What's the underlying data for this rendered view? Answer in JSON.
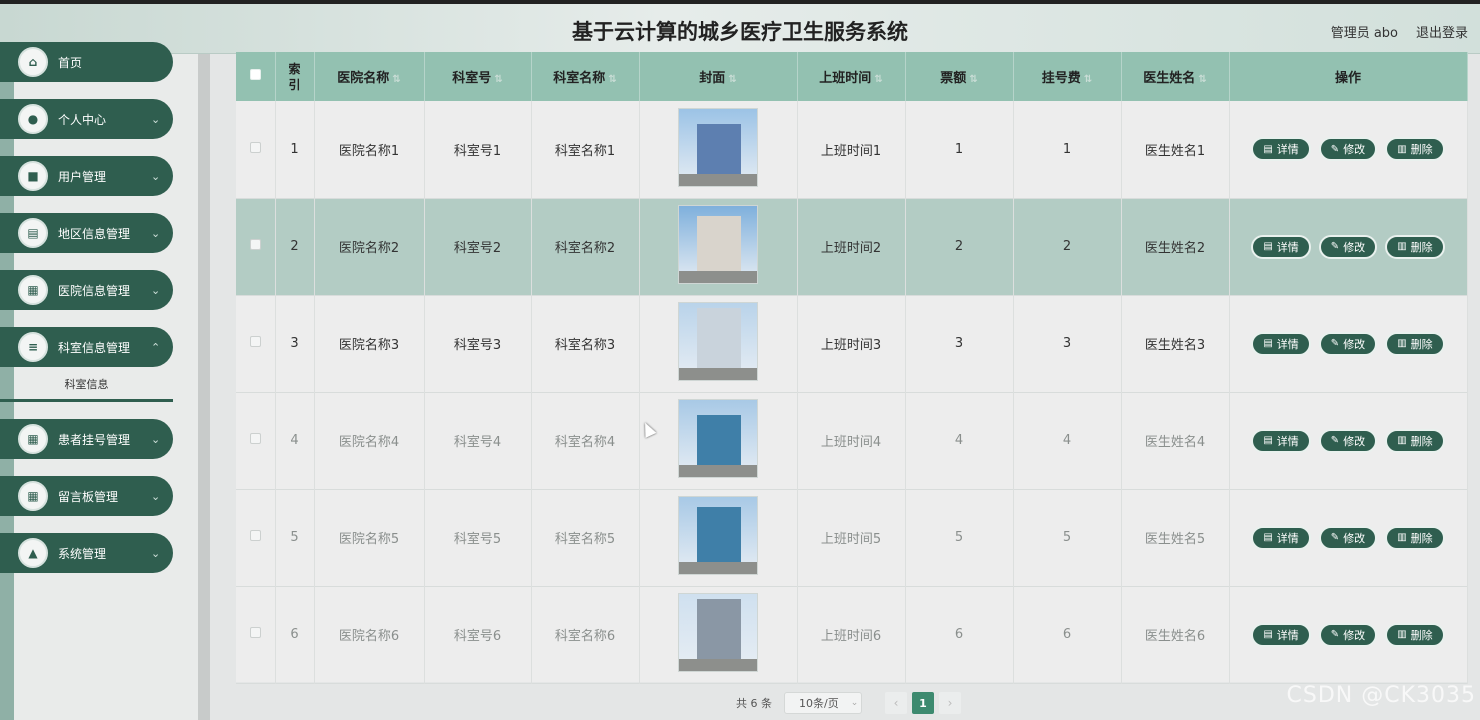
{
  "header": {
    "title": "基于云计算的城乡医疗卫生服务系统",
    "admin_label": "管理员 abo",
    "logout_label": "退出登录"
  },
  "sidebar": {
    "items": [
      {
        "label": "首页",
        "icon": "home-icon"
      },
      {
        "label": "个人中心",
        "icon": "user-icon"
      },
      {
        "label": "用户管理",
        "icon": "briefcase-icon"
      },
      {
        "label": "地区信息管理",
        "icon": "document-icon"
      },
      {
        "label": "医院信息管理",
        "icon": "grid-icon"
      },
      {
        "label": "科室信息管理",
        "icon": "list-icon"
      },
      {
        "label": "患者挂号管理",
        "icon": "grid-icon"
      },
      {
        "label": "留言板管理",
        "icon": "grid-icon"
      },
      {
        "label": "系统管理",
        "icon": "person-icon"
      }
    ],
    "active_sub": "科室信息"
  },
  "table": {
    "headers": {
      "index": "索引",
      "hospital": "医院名称",
      "dept_no": "科室号",
      "dept_name": "科室名称",
      "cover": "封面",
      "shift": "上班时间",
      "ticket": "票额",
      "fee": "挂号费",
      "doctor": "医生姓名",
      "ops": "操作"
    },
    "rows": [
      {
        "index": "1",
        "hospital": "医院名称1",
        "dept_no": "科室号1",
        "dept_name": "科室名称1",
        "shift": "上班时间1",
        "ticket": "1",
        "fee": "1",
        "doctor": "医生姓名1"
      },
      {
        "index": "2",
        "hospital": "医院名称2",
        "dept_no": "科室号2",
        "dept_name": "科室名称2",
        "shift": "上班时间2",
        "ticket": "2",
        "fee": "2",
        "doctor": "医生姓名2"
      },
      {
        "index": "3",
        "hospital": "医院名称3",
        "dept_no": "科室号3",
        "dept_name": "科室名称3",
        "shift": "上班时间3",
        "ticket": "3",
        "fee": "3",
        "doctor": "医生姓名3"
      },
      {
        "index": "4",
        "hospital": "医院名称4",
        "dept_no": "科室号4",
        "dept_name": "科室名称4",
        "shift": "上班时间4",
        "ticket": "4",
        "fee": "4",
        "doctor": "医生姓名4"
      },
      {
        "index": "5",
        "hospital": "医院名称5",
        "dept_no": "科室号5",
        "dept_name": "科室名称5",
        "shift": "上班时间5",
        "ticket": "5",
        "fee": "5",
        "doctor": "医生姓名5"
      },
      {
        "index": "6",
        "hospital": "医院名称6",
        "dept_no": "科室号6",
        "dept_name": "科室名称6",
        "shift": "上班时间6",
        "ticket": "6",
        "fee": "6",
        "doctor": "医生姓名6"
      }
    ],
    "actions": {
      "detail": "详情",
      "edit": "修改",
      "delete": "删除"
    }
  },
  "pager": {
    "total": "共 6 条",
    "page_size": "10条/页",
    "current_page": "1"
  },
  "watermark": "CSDN @CK3035",
  "colors": {
    "primary": "#2f5e4f",
    "header_row": "#93c1b1",
    "highlight_row": "#b3ccc4",
    "page_active": "#3d8a6f"
  }
}
